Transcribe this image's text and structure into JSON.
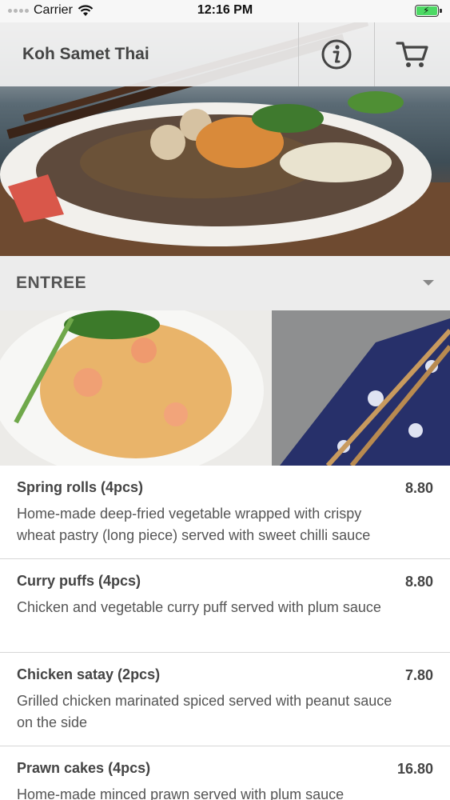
{
  "status_bar": {
    "carrier": "Carrier",
    "time": "12:16 PM"
  },
  "header": {
    "title": "Koh Samet Thai",
    "info_icon": "info-icon",
    "cart_icon": "cart-icon"
  },
  "category": {
    "label": "ENTREE"
  },
  "menu": {
    "items": [
      {
        "name": "Spring rolls (4pcs)",
        "price": "8.80",
        "description": "Home-made deep-fried vegetable wrapped with crispy wheat pastry (long piece) served with sweet chilli sauce"
      },
      {
        "name": "Curry puffs (4pcs)",
        "price": "8.80",
        "description": "Chicken and vegetable curry puff served with plum sauce"
      },
      {
        "name": "Chicken satay (2pcs)",
        "price": "7.80",
        "description": "Grilled chicken marinated spiced served with peanut sauce on the side"
      },
      {
        "name": "Prawn cakes (4pcs)",
        "price": "16.80",
        "description": "Home-made minced prawn served with plum sauce"
      }
    ]
  }
}
